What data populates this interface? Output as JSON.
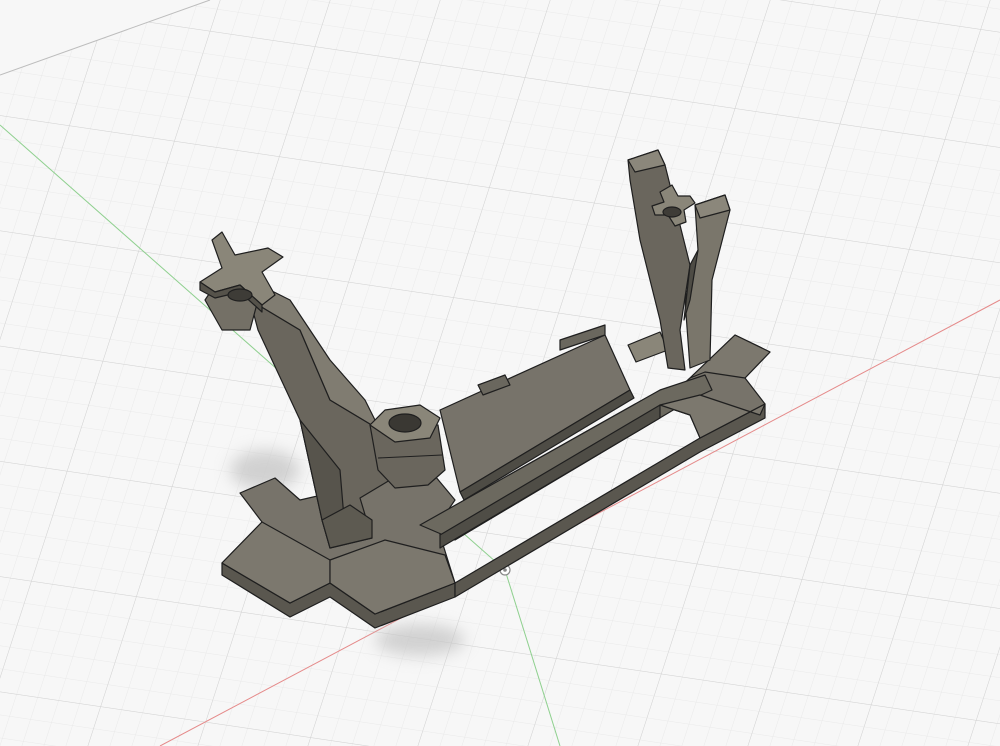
{
  "viewport": {
    "label": "",
    "colors": {
      "background": "#f7f7f7",
      "grid_minor": "#e4e4e4",
      "grid_major": "#cfcfcf",
      "x_axis": "#e58a8a",
      "y_axis": "#8fd08f",
      "model_top": "#7a766b",
      "model_side": "#5e5b52",
      "model_dark": "#4a4842",
      "model_light": "#8b877b",
      "edge": "#1e1e1e",
      "shadow": "#c9c9c9"
    }
  },
  "model": {
    "name_icon": "stand-model",
    "origin_icon": "origin-marker-icon"
  }
}
